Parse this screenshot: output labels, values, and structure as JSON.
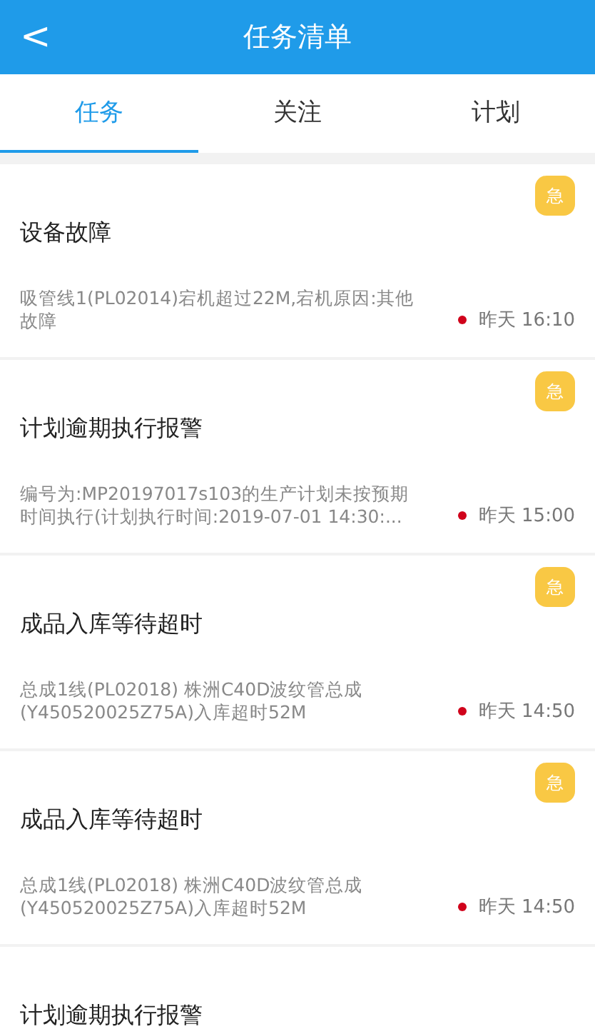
{
  "header": {
    "back": "<",
    "title": "任务清单"
  },
  "tabs": [
    {
      "label": "任务",
      "selected": true
    },
    {
      "label": "关注",
      "selected": false
    },
    {
      "label": "计划",
      "selected": false
    }
  ],
  "tasks": [
    {
      "badge": "急",
      "title": "设备故障",
      "description": "吸管线1(PL02014)宕机超过22M,宕机原因:其他故障",
      "unread": true,
      "time": "昨天 16:10"
    },
    {
      "badge": "急",
      "title": "计划逾期执行报警",
      "description": "编号为:MP20197017s103的生产计划未按预期时间执行(计划执行时间:2019-07-01 14:30:...",
      "unread": true,
      "time": "昨天 15:00"
    },
    {
      "badge": "急",
      "title": "成品入库等待超时",
      "description": "总成1线(PL02018) 株洲C40D波纹管总成(Y450520025Z75A)入库超时52M",
      "unread": true,
      "time": "昨天 14:50"
    },
    {
      "badge": "急",
      "title": "成品入库等待超时",
      "description": "总成1线(PL02018) 株洲C40D波纹管总成(Y450520025Z75A)入库超时52M",
      "unread": true,
      "time": "昨天 14:50"
    },
    {
      "title": "计划逾期执行报警"
    }
  ]
}
